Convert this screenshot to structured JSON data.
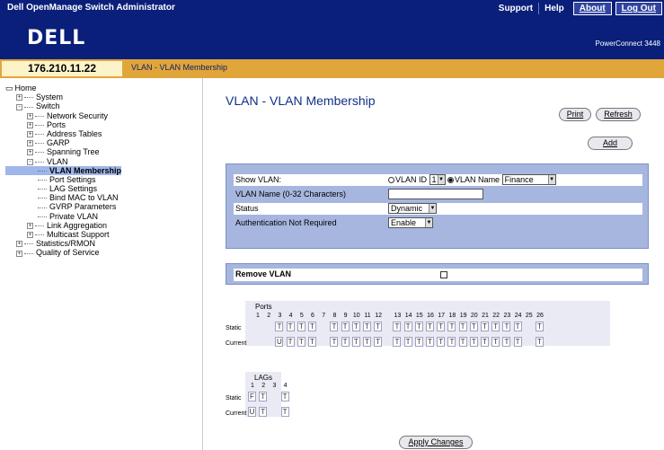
{
  "app": {
    "title": "Dell OpenManage Switch Administrator",
    "links": [
      "Support",
      "Help",
      "About",
      "Log Out"
    ],
    "logo": "DELL",
    "product": "PowerConnect 3448",
    "ip": "176.210.11.22",
    "breadcrumb": "VLAN - VLAN Membership"
  },
  "tree": [
    {
      "label": "Home",
      "level": 0,
      "icon": "home"
    },
    {
      "label": "System",
      "level": 1,
      "pm": "+"
    },
    {
      "label": "Switch",
      "level": 1,
      "pm": "-"
    },
    {
      "label": "Network Security",
      "level": 2,
      "pm": "+"
    },
    {
      "label": "Ports",
      "level": 2,
      "pm": "+"
    },
    {
      "label": "Address Tables",
      "level": 2,
      "pm": "+"
    },
    {
      "label": "GARP",
      "level": 2,
      "pm": "+"
    },
    {
      "label": "Spanning Tree",
      "level": 2,
      "pm": "+"
    },
    {
      "label": "VLAN",
      "level": 2,
      "pm": "-"
    },
    {
      "label": "VLAN Membership",
      "level": 3,
      "selected": true
    },
    {
      "label": "Port Settings",
      "level": 3
    },
    {
      "label": "LAG Settings",
      "level": 3
    },
    {
      "label": "Bind MAC to VLAN",
      "level": 3
    },
    {
      "label": "GVRP Parameters",
      "level": 3
    },
    {
      "label": "Private VLAN",
      "level": 3
    },
    {
      "label": "Link Aggregation",
      "level": 2,
      "pm": "+"
    },
    {
      "label": "Multicast Support",
      "level": 2,
      "pm": "+"
    },
    {
      "label": "Statistics/RMON",
      "level": 1,
      "pm": "+"
    },
    {
      "label": "Quality of Service",
      "level": 1,
      "pm": "+"
    }
  ],
  "main": {
    "title": "VLAN - VLAN Membership",
    "print": "Print",
    "refresh": "Refresh",
    "add": "Add",
    "show_vlan_label": "Show VLAN:",
    "vlan_id_radio": "VLAN ID",
    "vlan_id_value": "1",
    "vlan_name_radio": "VLAN Name",
    "vlan_name_value": "Finance",
    "vlan_name_field_label": "VLAN Name (0-32 Characters)",
    "vlan_name_field_value": "",
    "status_label": "Status",
    "status_value": "Dynamic",
    "auth_label": "Authentication Not Required",
    "auth_value": "Enable",
    "remove_label": "Remove VLAN",
    "ports_label": "Ports",
    "static_label": "Static",
    "current_label": "Current",
    "lags_label": "LAGs",
    "apply": "Apply Changes"
  },
  "ports": {
    "numbers": [
      "1",
      "2",
      "3",
      "4",
      "5",
      "6",
      "7",
      "8",
      "9",
      "10",
      "11",
      "12",
      "13",
      "14",
      "15",
      "16",
      "17",
      "18",
      "19",
      "20",
      "21",
      "22",
      "23",
      "24",
      "25",
      "26"
    ],
    "static": [
      "",
      "",
      "T",
      "T",
      "T",
      "T",
      "",
      "T",
      "T",
      "T",
      "T",
      "T",
      "T",
      "T",
      "T",
      "T",
      "T",
      "T",
      "T",
      "T",
      "T",
      "T",
      "T",
      "T",
      "",
      "T"
    ],
    "current": [
      "",
      "",
      "U",
      "T",
      "T",
      "T",
      "",
      "T",
      "T",
      "T",
      "T",
      "T",
      "T",
      "T",
      "T",
      "T",
      "T",
      "T",
      "T",
      "T",
      "T",
      "T",
      "T",
      "T",
      "",
      "T"
    ]
  },
  "lags": {
    "numbers": [
      "1",
      "2",
      "3",
      "4"
    ],
    "static": [
      "F",
      "T",
      "",
      "T"
    ],
    "current": [
      "U",
      "T",
      "",
      "T"
    ]
  }
}
